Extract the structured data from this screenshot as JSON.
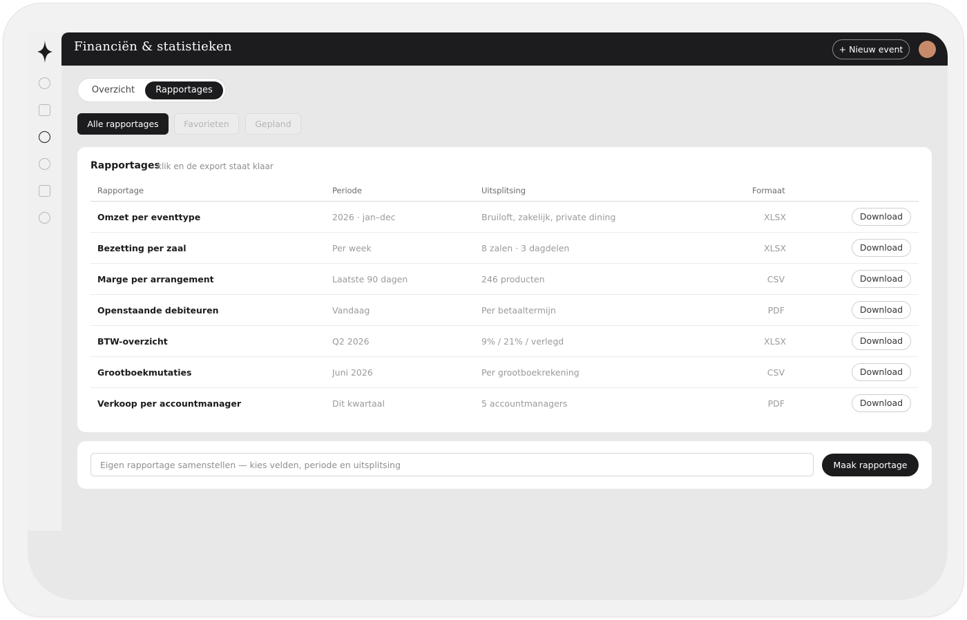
{
  "header": {
    "title": "Financiën & statistieken",
    "new_event_label": "+ Nieuw event"
  },
  "sidebar": {
    "logo": "diamond-star-icon",
    "items": [
      {
        "icon": "circle-icon",
        "active": false
      },
      {
        "icon": "square-icon",
        "active": false
      },
      {
        "icon": "circle-icon",
        "active": true
      },
      {
        "icon": "circle-icon",
        "active": false
      },
      {
        "icon": "square-icon",
        "active": false
      },
      {
        "icon": "circle-icon",
        "active": false
      }
    ]
  },
  "tabs": [
    {
      "label": "Overzicht",
      "active": false
    },
    {
      "label": "Rapportages",
      "active": true
    }
  ],
  "filters": [
    {
      "label": "Alle rapportages",
      "active": true
    },
    {
      "label": "Favorieten",
      "active": false
    },
    {
      "label": "Gepland",
      "active": false
    }
  ],
  "reports": {
    "title": "Rapportages",
    "subtitle": "klik en de export staat klaar",
    "columns": {
      "name": "Rapportage",
      "period": "Periode",
      "split": "Uitsplitsing",
      "format": "Formaat"
    },
    "download_label": "Download",
    "rows": [
      {
        "name": "Omzet per eventtype",
        "period": "2026 · jan–dec",
        "split": "Bruiloft, zakelijk, private dining",
        "format": "XLSX"
      },
      {
        "name": "Bezetting per zaal",
        "period": "Per week",
        "split": "8 zalen · 3 dagdelen",
        "format": "XLSX"
      },
      {
        "name": "Marge per arrangement",
        "period": "Laatste 90 dagen",
        "split": "246 producten",
        "format": "CSV"
      },
      {
        "name": "Openstaande debiteuren",
        "period": "Vandaag",
        "split": "Per betaaltermijn",
        "format": "PDF"
      },
      {
        "name": "BTW-overzicht",
        "period": "Q2 2026",
        "split": "9% / 21% / verlegd",
        "format": "XLSX"
      },
      {
        "name": "Grootboekmutaties",
        "period": "Juni 2026",
        "split": "Per grootboekrekening",
        "format": "CSV"
      },
      {
        "name": "Verkoop per accountmanager",
        "period": "Dit kwartaal",
        "split": "5 accountmanagers",
        "format": "PDF"
      }
    ]
  },
  "builder": {
    "placeholder": "Eigen rapportage samenstellen — kies velden, periode en uitsplitsing",
    "value": "",
    "button_label": "Maak rapportage"
  },
  "colors": {
    "dark": "#1c1b1d",
    "avatar": "#c98a6b",
    "background": "#e8e8e8",
    "card": "#ffffff"
  }
}
